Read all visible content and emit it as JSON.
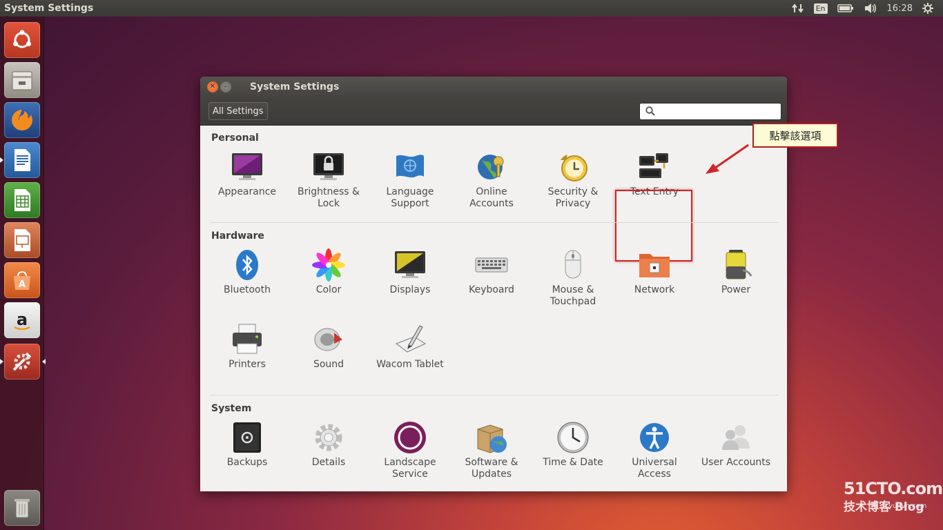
{
  "top_panel": {
    "title": "System Settings",
    "keyboard_layout": "En",
    "time": "16:28"
  },
  "launcher": {
    "items": [
      "ubuntu-dash-icon",
      "files-icon",
      "firefox-icon",
      "libreoffice-writer-icon",
      "libreoffice-calc-icon",
      "libreoffice-impress-icon",
      "software-center-icon",
      "amazon-icon",
      "system-settings-icon",
      "trash-icon"
    ]
  },
  "window": {
    "title": "System Settings",
    "all_settings_label": "All Settings",
    "search_placeholder": ""
  },
  "sections": {
    "personal": {
      "title": "Personal",
      "items": [
        {
          "label1": "Appearance",
          "label2": ""
        },
        {
          "label1": "Brightness &",
          "label2": "Lock"
        },
        {
          "label1": "Language",
          "label2": "Support"
        },
        {
          "label1": "Online",
          "label2": "Accounts"
        },
        {
          "label1": "Security &",
          "label2": "Privacy"
        },
        {
          "label1": "Text Entry",
          "label2": ""
        }
      ]
    },
    "hardware": {
      "title": "Hardware",
      "items": [
        {
          "label1": "Bluetooth",
          "label2": ""
        },
        {
          "label1": "Color",
          "label2": ""
        },
        {
          "label1": "Displays",
          "label2": ""
        },
        {
          "label1": "Keyboard",
          "label2": ""
        },
        {
          "label1": "Mouse &",
          "label2": "Touchpad"
        },
        {
          "label1": "Network",
          "label2": ""
        },
        {
          "label1": "Power",
          "label2": ""
        },
        {
          "label1": "Printers",
          "label2": ""
        },
        {
          "label1": "Sound",
          "label2": ""
        },
        {
          "label1": "Wacom Tablet",
          "label2": ""
        }
      ]
    },
    "system": {
      "title": "System",
      "items": [
        {
          "label1": "Backups",
          "label2": ""
        },
        {
          "label1": "Details",
          "label2": ""
        },
        {
          "label1": "Landscape",
          "label2": "Service"
        },
        {
          "label1": "Software &",
          "label2": "Updates"
        },
        {
          "label1": "Time & Date",
          "label2": ""
        },
        {
          "label1": "Universal",
          "label2": "Access"
        },
        {
          "label1": "User Accounts",
          "label2": ""
        }
      ]
    }
  },
  "annotation": {
    "text": "點擊該選項"
  },
  "watermark": {
    "line1": "51CTO.com",
    "line2": "技术博客",
    "line3": "Blog",
    "url": "yunvn.com"
  },
  "colors": {
    "highlight": "#d12424",
    "accent": "#e3551d"
  }
}
